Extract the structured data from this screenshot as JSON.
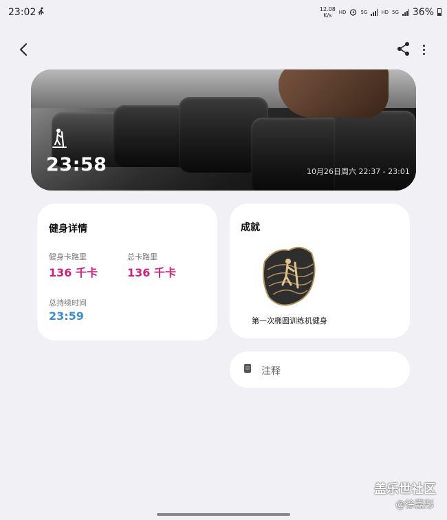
{
  "status_bar": {
    "time": "23:02",
    "net_speed_value": "12.08",
    "net_speed_unit": "K/s",
    "hd1": "HD",
    "net1": "5G",
    "hd2": "HD",
    "net2": "5G",
    "battery": "36%",
    "battery_level": 0.36
  },
  "hero": {
    "duration": "23:58",
    "datetime": "10月26日周六 22:37 - 23:01",
    "activity_icon": "elliptical-walker-icon"
  },
  "details": {
    "title": "健身详情",
    "workout_cal_label": "健身卡路里",
    "workout_cal_value": "136 千卡",
    "total_cal_label": "总卡路里",
    "total_cal_value": "136 千卡",
    "total_duration_label": "总持续时间",
    "total_duration_value": "23:59"
  },
  "achievements": {
    "title": "成就",
    "badge_caption": "第一次椭圆训练机健身"
  },
  "note": {
    "label": "注释"
  },
  "watermark": {
    "main": "盖乐世社区",
    "sub": "@徐嘉彤"
  },
  "colors": {
    "pink": "#c8247a",
    "blue": "#3a8fd0",
    "background": "#f0f0f5"
  }
}
